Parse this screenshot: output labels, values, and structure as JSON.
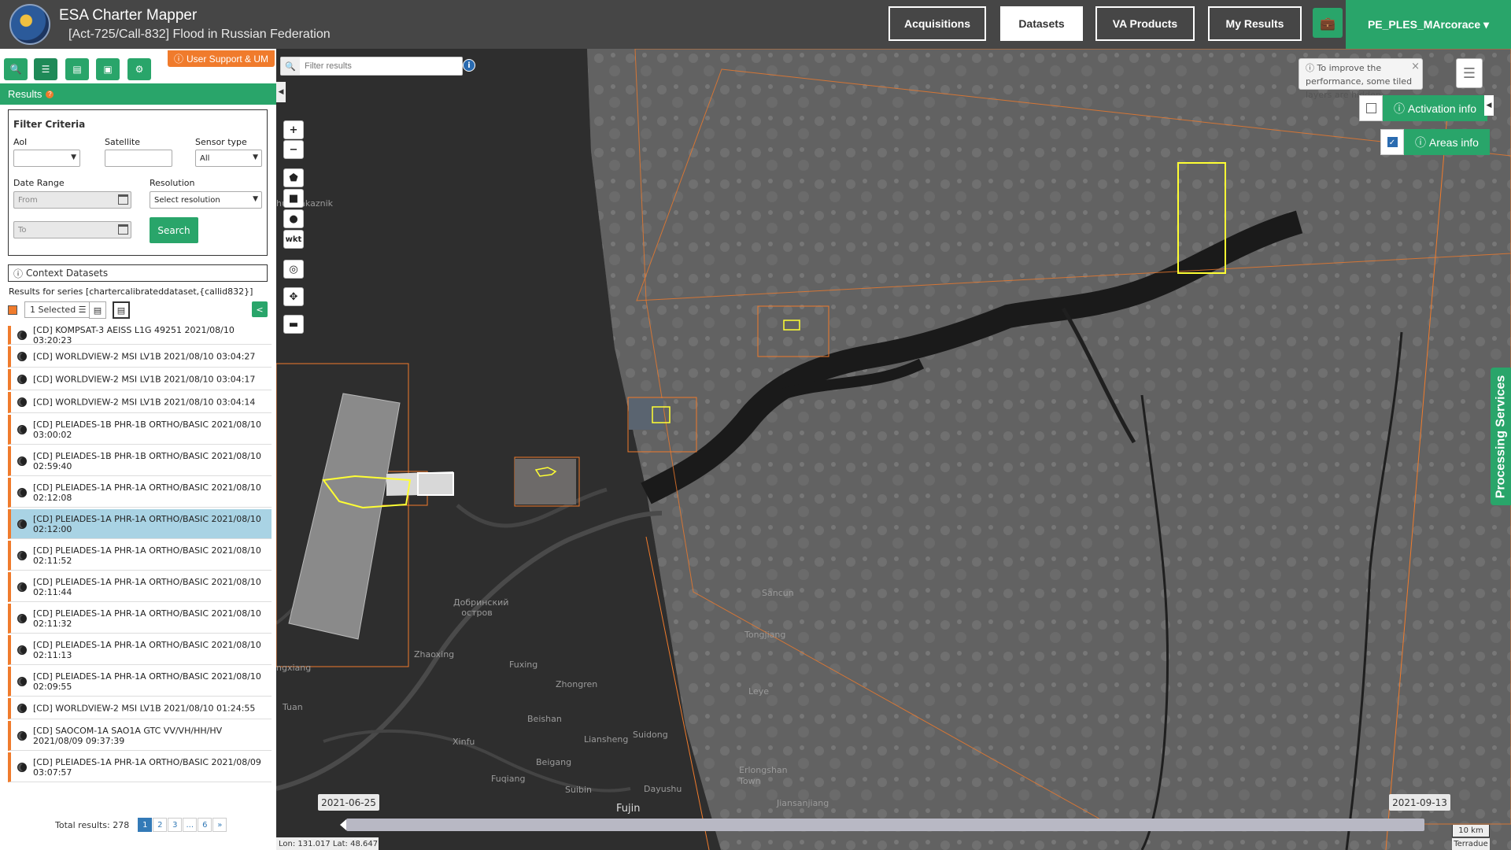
{
  "header": {
    "title": "ESA Charter Mapper",
    "subtitle": "[Act-725/Call-832] Flood in Russian Federation",
    "nav": {
      "acquisitions": "Acquisitions",
      "datasets": "Datasets",
      "va_products": "VA Products",
      "my_results": "My Results"
    },
    "user": "PE_PLES_MArcorace ▾"
  },
  "sidebar": {
    "support_link": "User Support & UM",
    "results_label": "Results",
    "filter": {
      "title": "Filter Criteria",
      "aoi_label": "AoI",
      "satellite_label": "Satellite",
      "sensor_label": "Sensor type",
      "sensor_value": "All",
      "date_label": "Date Range",
      "date_from_placeholder": "From",
      "date_to_placeholder": "To",
      "resolution_label": "Resolution",
      "resolution_value": "Select resolution",
      "search_button": "Search"
    },
    "context_datasets": "Context Datasets",
    "series_text": "Results for series [chartercalibrateddataset,{callid832}]",
    "selected_label": "1 Selected ☰",
    "results": [
      "[CD] KOMPSAT-3 AEISS L1G 49251 2021/08/10 03:20:23",
      "[CD] WORLDVIEW-2 MSI LV1B 2021/08/10 03:04:27",
      "[CD] WORLDVIEW-2 MSI LV1B 2021/08/10 03:04:17",
      "[CD] WORLDVIEW-2 MSI LV1B 2021/08/10 03:04:14",
      "[CD] PLEIADES-1B PHR-1B ORTHO/BASIC 2021/08/10 03:00:02",
      "[CD] PLEIADES-1B PHR-1B ORTHO/BASIC 2021/08/10 02:59:40",
      "[CD] PLEIADES-1A PHR-1A ORTHO/BASIC 2021/08/10 02:12:08",
      "[CD] PLEIADES-1A PHR-1A ORTHO/BASIC 2021/08/10 02:12:00",
      "[CD] PLEIADES-1A PHR-1A ORTHO/BASIC 2021/08/10 02:11:52",
      "[CD] PLEIADES-1A PHR-1A ORTHO/BASIC 2021/08/10 02:11:44",
      "[CD] PLEIADES-1A PHR-1A ORTHO/BASIC 2021/08/10 02:11:32",
      "[CD] PLEIADES-1A PHR-1A ORTHO/BASIC 2021/08/10 02:11:13",
      "[CD] PLEIADES-1A PHR-1A ORTHO/BASIC 2021/08/10 02:09:55",
      "[CD] WORLDVIEW-2 MSI LV1B 2021/08/10 01:24:55",
      "[CD] SAOCOM-1A SAO1A GTC VV/VH/HH/HV 2021/08/09 09:37:39",
      "[CD] PLEIADES-1A PHR-1A ORTHO/BASIC 2021/08/09 03:07:57"
    ],
    "selected_index": 7,
    "total_results": "Total results: 278",
    "pages": [
      "1",
      "2",
      "3",
      "...",
      "6",
      "»"
    ]
  },
  "map": {
    "filter_placeholder": "Filter results",
    "perf_note": "To improve the performance, some tiled layers are hidden.",
    "activation_info": "Activation info",
    "areas_info": "Areas info",
    "processing_services": "Processing Services",
    "timeline_start": "2021-06-25",
    "timeline_end": "2021-09-13",
    "coords": "Lon: 131.017 Lat: 48.647",
    "scale": "10 km",
    "attribution": "Terradue",
    "wkt": "wkt",
    "labels": {
      "dobrinsky": "Добринский остров",
      "fuxing": "Fuxing",
      "zhongren": "Zhongren",
      "beishan": "Beishan",
      "xinfu": "Xinfu",
      "liansheng": "Liansheng",
      "suidong": "Suidong",
      "beigang": "Beigang",
      "fuqiang": "Fuqiang",
      "suibin": "Suibin",
      "dayushu": "Dayushu",
      "fujin": "Fujin",
      "tongjiang": "Tongjiang",
      "sancun": "Sancun",
      "leye": "Leye",
      "erlongshan": "Erlongshan Town",
      "jiansanjiang": "Jiansanjiang",
      "zakaznik": "hun zakaznik",
      "ngxiang": "ngxiang",
      "tuan": "Tuan",
      "zhaoxing": "Zhaoxing"
    }
  },
  "colors": {
    "brand_green": "#29a56a",
    "accent_orange": "#f07b2c",
    "footprint_yellow": "#ffff33",
    "header_grey": "#464646"
  }
}
